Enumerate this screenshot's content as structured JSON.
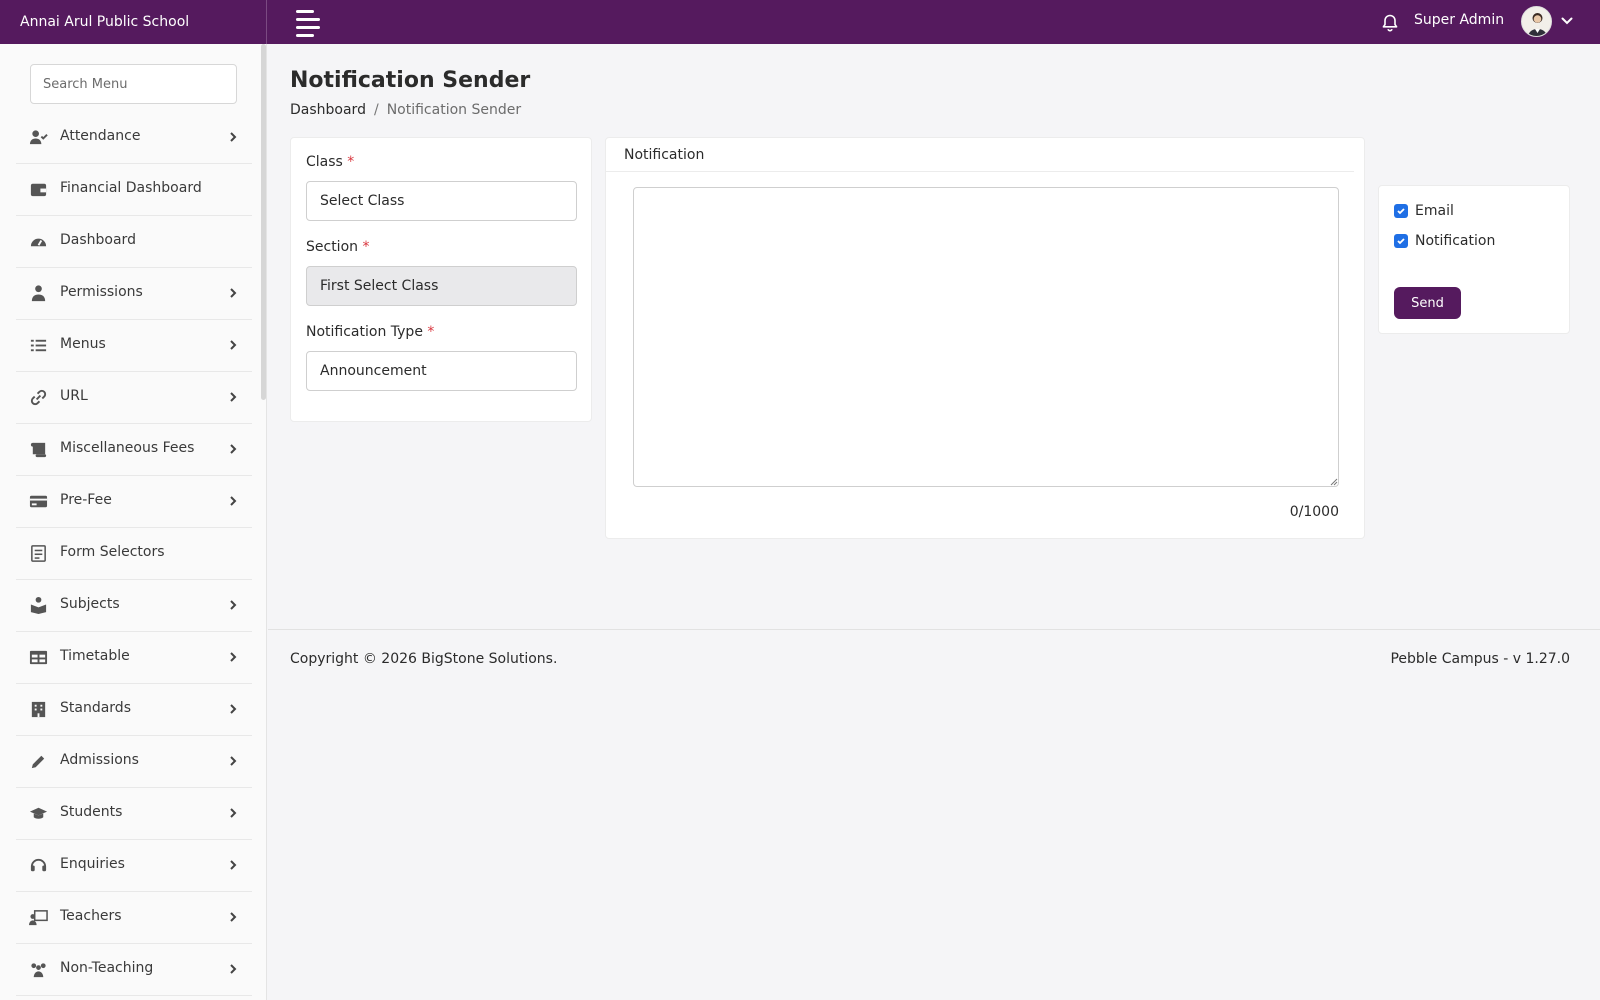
{
  "header": {
    "brand": "Annai Arul Public School",
    "user_name": "Super Admin"
  },
  "sidebar": {
    "search_placeholder": "Search Menu",
    "items": [
      {
        "label": "Attendance",
        "icon": "user-check-icon",
        "has_submenu": true
      },
      {
        "label": "Financial Dashboard",
        "icon": "wallet-icon",
        "has_submenu": false
      },
      {
        "label": "Dashboard",
        "icon": "gauge-icon",
        "has_submenu": false
      },
      {
        "label": "Permissions",
        "icon": "user-shield-icon",
        "has_submenu": true
      },
      {
        "label": "Menus",
        "icon": "list-icon",
        "has_submenu": true
      },
      {
        "label": "URL",
        "icon": "link-icon",
        "has_submenu": true
      },
      {
        "label": "Miscellaneous Fees",
        "icon": "scroll-icon",
        "has_submenu": true
      },
      {
        "label": "Pre-Fee",
        "icon": "credit-card-icon",
        "has_submenu": true
      },
      {
        "label": "Form Selectors",
        "icon": "form-icon",
        "has_submenu": false
      },
      {
        "label": "Subjects",
        "icon": "book-reader-icon",
        "has_submenu": true
      },
      {
        "label": "Timetable",
        "icon": "table-icon",
        "has_submenu": true
      },
      {
        "label": "Standards",
        "icon": "building-icon",
        "has_submenu": true
      },
      {
        "label": "Admissions",
        "icon": "pencil-icon",
        "has_submenu": true
      },
      {
        "label": "Students",
        "icon": "graduation-cap-icon",
        "has_submenu": true
      },
      {
        "label": "Enquiries",
        "icon": "headset-icon",
        "has_submenu": true
      },
      {
        "label": "Teachers",
        "icon": "chalkboard-teacher-icon",
        "has_submenu": true
      },
      {
        "label": "Non-Teaching",
        "icon": "users-icon",
        "has_submenu": true
      }
    ]
  },
  "page": {
    "title": "Notification Sender",
    "breadcrumb_home": "Dashboard",
    "breadcrumb_separator": "/",
    "breadcrumb_current": "Notification Sender"
  },
  "form": {
    "class_label": "Class",
    "class_value": "Select Class",
    "section_label": "Section",
    "section_value": "First Select Class",
    "type_label": "Notification Type",
    "type_value": "Announcement",
    "required_mark": "*"
  },
  "notification": {
    "header": "Notification",
    "message": "",
    "char_count": "0/1000"
  },
  "options": {
    "email_label": "Email",
    "email_checked": true,
    "notification_label": "Notification",
    "notification_checked": true,
    "send_label": "Send"
  },
  "footer": {
    "copyright": "Copyright © 2026 BigStone Solutions.",
    "version": "Pebble Campus - v 1.27.0"
  },
  "colors": {
    "brand_purple": "#551a5e",
    "checkbox_blue": "#1f6fe5",
    "required_red": "#d9363e"
  }
}
